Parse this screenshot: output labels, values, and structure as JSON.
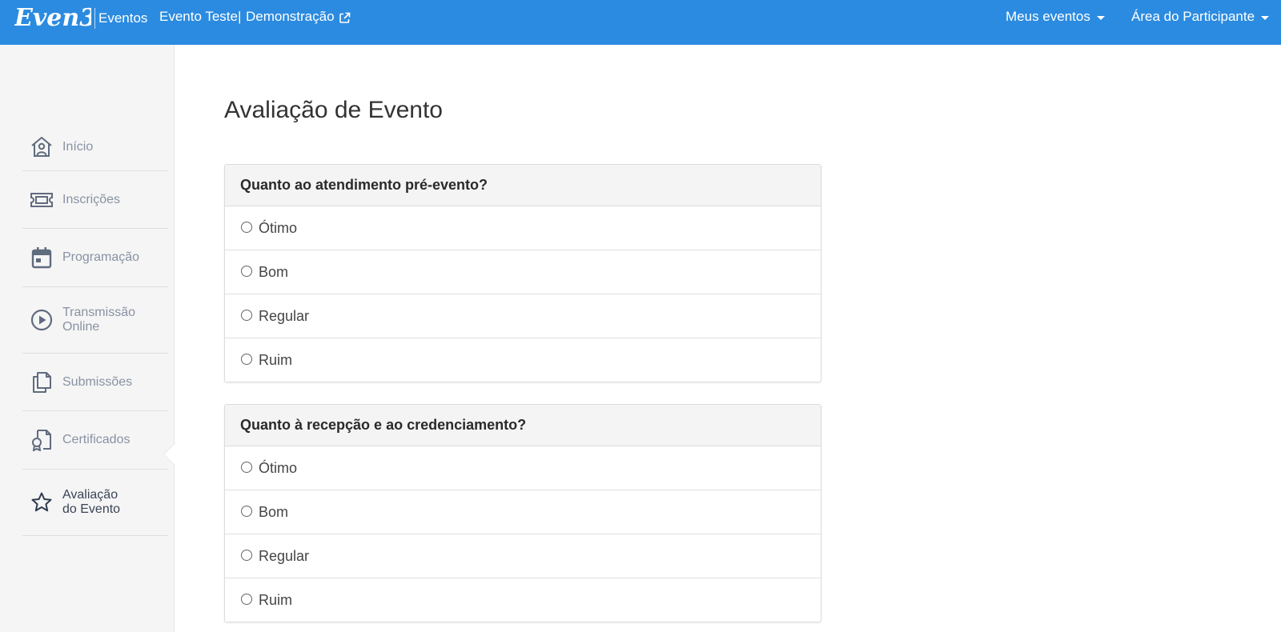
{
  "header": {
    "logo_text": "Even3",
    "brand_section": "Eventos",
    "event_name": "Evento Teste",
    "event_separator": "|",
    "event_demo_label": "Demonstração",
    "nav_meus_eventos": "Meus eventos",
    "nav_area_participante": "Área do Participante",
    "bg_color": "#2b8be0"
  },
  "sidebar": {
    "items": [
      {
        "label": "Início",
        "icon": "home-user-icon",
        "active": false
      },
      {
        "label": "Inscrições",
        "icon": "ticket-icon",
        "active": false
      },
      {
        "label": "Programação",
        "icon": "calendar-icon",
        "active": false
      },
      {
        "label": "Transmissão\nOnline",
        "icon": "play-circle-icon",
        "active": false
      },
      {
        "label": "Submissões",
        "icon": "copy-documents-icon",
        "active": false
      },
      {
        "label": "Certificados",
        "icon": "certificate-icon",
        "active": false
      },
      {
        "label": "Avaliação\ndo Evento",
        "icon": "star-icon",
        "active": true
      }
    ]
  },
  "main": {
    "title": "Avaliação de Evento",
    "questions": [
      {
        "question": "Quanto ao atendimento pré-evento?",
        "options": [
          "Ótimo",
          "Bom",
          "Regular",
          "Ruim"
        ]
      },
      {
        "question": "Quanto à recepção e ao credenciamento?",
        "options": [
          "Ótimo",
          "Bom",
          "Regular",
          "Ruim"
        ]
      }
    ]
  }
}
